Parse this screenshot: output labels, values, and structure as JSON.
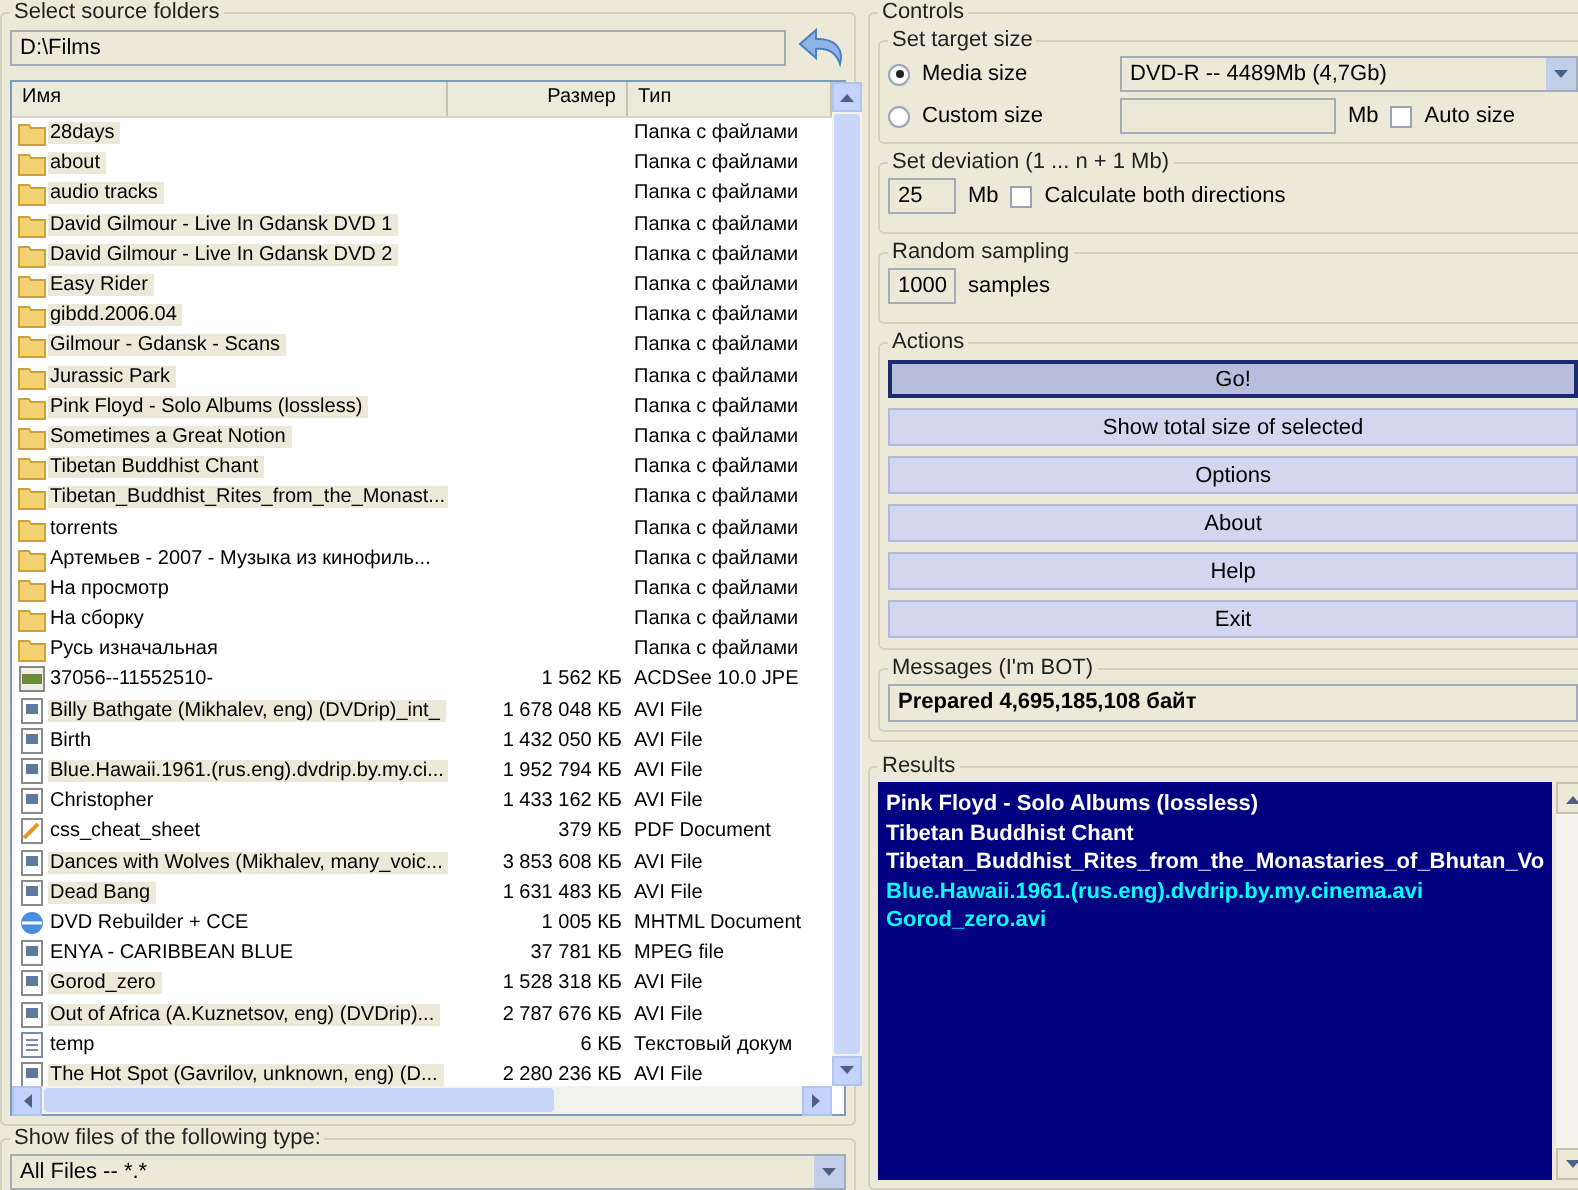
{
  "source": {
    "title": "Select source folders",
    "path": "D:\\Films"
  },
  "list": {
    "columns": [
      "Имя",
      "Размер",
      "Тип"
    ],
    "rows": [
      {
        "kind": "folder",
        "name": "28days",
        "size": "",
        "type": "Папка с файлами",
        "highlighted": true
      },
      {
        "kind": "folder",
        "name": "about",
        "size": "",
        "type": "Папка с файлами",
        "highlighted": true
      },
      {
        "kind": "folder",
        "name": "audio tracks",
        "size": "",
        "type": "Папка с файлами",
        "highlighted": true
      },
      {
        "kind": "folder",
        "name": "David Gilmour - Live In Gdansk DVD 1",
        "size": "",
        "type": "Папка с файлами",
        "highlighted": true
      },
      {
        "kind": "folder",
        "name": "David Gilmour - Live In Gdansk DVD 2",
        "size": "",
        "type": "Папка с файлами",
        "highlighted": true
      },
      {
        "kind": "folder",
        "name": "Easy Rider",
        "size": "",
        "type": "Папка с файлами",
        "highlighted": true
      },
      {
        "kind": "folder",
        "name": "gibdd.2006.04",
        "size": "",
        "type": "Папка с файлами",
        "highlighted": true
      },
      {
        "kind": "folder",
        "name": "Gilmour - Gdansk - Scans",
        "size": "",
        "type": "Папка с файлами",
        "highlighted": true
      },
      {
        "kind": "folder",
        "name": "Jurassic Park",
        "size": "",
        "type": "Папка с файлами",
        "highlighted": true
      },
      {
        "kind": "folder",
        "name": "Pink Floyd - Solo Albums (lossless)",
        "size": "",
        "type": "Папка с файлами",
        "highlighted": true
      },
      {
        "kind": "folder",
        "name": "Sometimes a Great Notion",
        "size": "",
        "type": "Папка с файлами",
        "highlighted": true
      },
      {
        "kind": "folder",
        "name": "Tibetan Buddhist Chant",
        "size": "",
        "type": "Папка с файлами",
        "highlighted": true
      },
      {
        "kind": "folder",
        "name": "Tibetan_Buddhist_Rites_from_the_Monast...",
        "size": "",
        "type": "Папка с файлами",
        "highlighted": true
      },
      {
        "kind": "folder",
        "name": "torrents",
        "size": "",
        "type": "Папка с файлами",
        "highlighted": false
      },
      {
        "kind": "folder",
        "name": "Артемьев - 2007 - Музыка из кинофиль...",
        "size": "",
        "type": "Папка с файлами",
        "highlighted": false
      },
      {
        "kind": "folder",
        "name": "На просмотр",
        "size": "",
        "type": "Папка с файлами",
        "highlighted": false
      },
      {
        "kind": "folder",
        "name": "На сборку",
        "size": "",
        "type": "Папка с файлами",
        "highlighted": false
      },
      {
        "kind": "folder",
        "name": "Русь изначальная",
        "size": "",
        "type": "Папка с файлами",
        "highlighted": false
      },
      {
        "kind": "image",
        "name": "37056--11552510-",
        "size": "1 562 КБ",
        "type": "ACDSee 10.0 JPE",
        "highlighted": false
      },
      {
        "kind": "video",
        "name": "Billy Bathgate (Mikhalev, eng) (DVDrip)_int_",
        "size": "1 678 048 КБ",
        "type": "AVI File",
        "highlighted": true
      },
      {
        "kind": "video",
        "name": "Birth",
        "size": "1 432 050 КБ",
        "type": "AVI File",
        "highlighted": false
      },
      {
        "kind": "video",
        "name": "Blue.Hawaii.1961.(rus.eng).dvdrip.by.my.ci...",
        "size": "1 952 794 КБ",
        "type": "AVI File",
        "highlighted": true
      },
      {
        "kind": "video",
        "name": "Christopher",
        "size": "1 433 162 КБ",
        "type": "AVI File",
        "highlighted": false
      },
      {
        "kind": "pdf",
        "name": "css_cheat_sheet",
        "size": "379 КБ",
        "type": "PDF Document",
        "highlighted": false
      },
      {
        "kind": "video",
        "name": "Dances with Wolves (Mikhalev, many_voic...",
        "size": "3 853 608 КБ",
        "type": "AVI File",
        "highlighted": true
      },
      {
        "kind": "video",
        "name": "Dead Bang",
        "size": "1 631 483 КБ",
        "type": "AVI File",
        "highlighted": true
      },
      {
        "kind": "web",
        "name": "DVD Rebuilder + CCE",
        "size": "1 005 КБ",
        "type": "MHTML Document",
        "highlighted": false
      },
      {
        "kind": "video",
        "name": "ENYA - CARIBBEAN BLUE",
        "size": "37 781 КБ",
        "type": "MPEG file",
        "highlighted": false
      },
      {
        "kind": "video",
        "name": "Gorod_zero",
        "size": "1 528 318 КБ",
        "type": "AVI File",
        "highlighted": true
      },
      {
        "kind": "video",
        "name": "Out of Africa (A.Kuznetsov, eng) (DVDrip)...",
        "size": "2 787 676 КБ",
        "type": "AVI File",
        "highlighted": true
      },
      {
        "kind": "text",
        "name": "temp",
        "size": "6 КБ",
        "type": "Текстовый докум",
        "highlighted": false
      },
      {
        "kind": "video",
        "name": "The Hot Spot (Gavrilov, unknown, eng) (D...",
        "size": "2 280 236 КБ",
        "type": "AVI File",
        "highlighted": true
      }
    ]
  },
  "filter": {
    "title": "Show files of the following type:",
    "value": "All Files -- *.*"
  },
  "controls": {
    "title": "Controls",
    "target": {
      "title": "Set target size",
      "options": [
        {
          "label": "Media size",
          "selected": true
        },
        {
          "label": "Custom size",
          "selected": false
        }
      ],
      "media": "DVD-R -- 4489Mb (4,7Gb)",
      "unit": "Mb",
      "auto": {
        "label": "Auto size",
        "checked": false
      }
    },
    "deviation": {
      "title": "Set deviation (1 ... n + 1 Mb)",
      "value": "25",
      "unit": "Mb",
      "both": {
        "label": "Calculate both directions",
        "checked": false
      }
    },
    "sampling": {
      "title": "Random sampling",
      "value": "1000",
      "unit": "samples"
    },
    "actions": {
      "title": "Actions",
      "buttons": [
        {
          "label": "Go!",
          "selected": true
        },
        {
          "label": "Show total size of selected",
          "selected": false
        },
        {
          "label": "Options",
          "selected": false
        },
        {
          "label": "About",
          "selected": false
        },
        {
          "label": "Help",
          "selected": false
        },
        {
          "label": "Exit",
          "selected": false
        }
      ]
    },
    "messages": {
      "title": "Messages (I'm BOT)",
      "text": "Prepared 4,695,185,108 байт"
    }
  },
  "results": {
    "title": "Results",
    "items": [
      {
        "text": "Pink Floyd - Solo Albums (lossless)",
        "color": "#ffffff"
      },
      {
        "text": "Tibetan Buddhist Chant",
        "color": "#ffffff"
      },
      {
        "text": "Tibetan_Buddhist_Rites_from_the_Monastaries_of_Bhutan_Vo",
        "color": "#ffffff"
      },
      {
        "text": "Blue.Hawaii.1961.(rus.eng).dvdrip.by.my.cinema.avi",
        "color": "#00ffff"
      },
      {
        "text": "Gorod_zero.avi",
        "color": "#00ffff"
      }
    ]
  }
}
